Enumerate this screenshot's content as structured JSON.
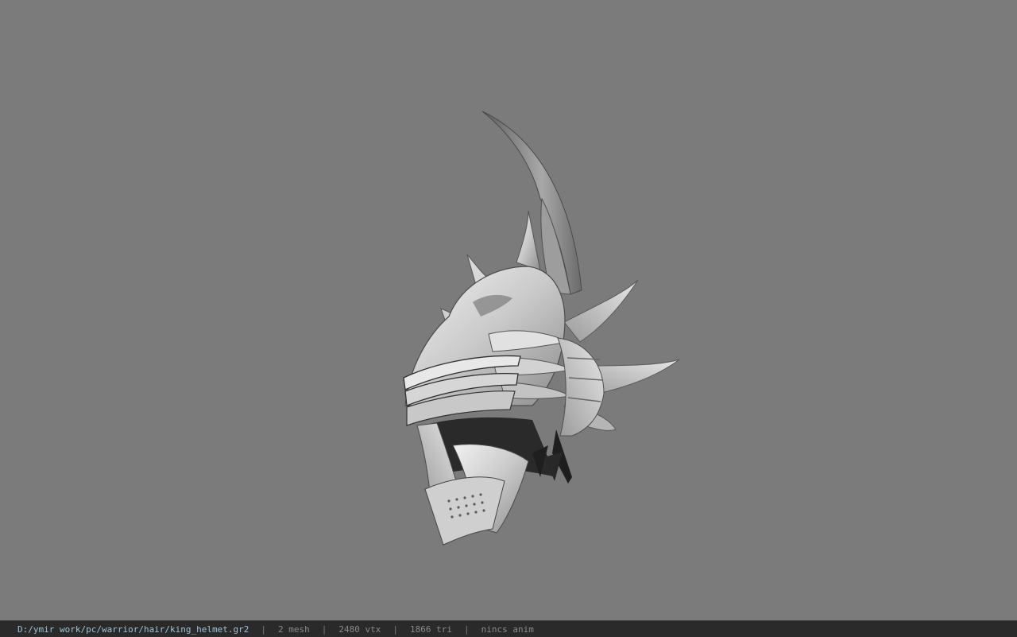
{
  "viewport": {
    "background": "#7b7b7b",
    "model_name": "helmet-model"
  },
  "statusbar": {
    "file_path": "D:/ymir work/pc/warrior/hair/king_helmet.gr2",
    "separator": "|",
    "mesh": "2 mesh",
    "vertices": "2480 vtx",
    "triangles": "1866 tri",
    "anim": "nincs anim"
  }
}
